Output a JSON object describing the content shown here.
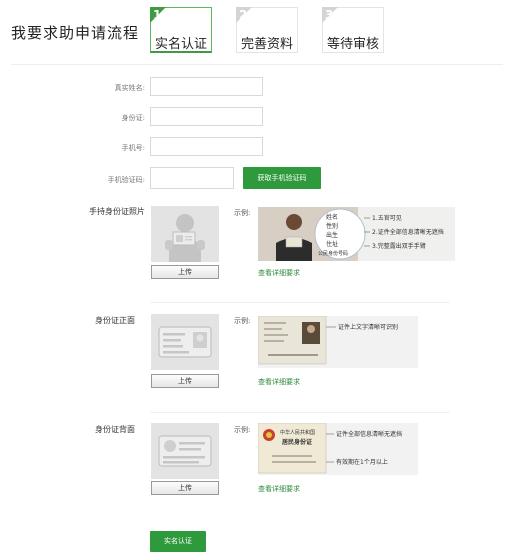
{
  "header": {
    "title": "我要求助申请流程"
  },
  "steps": [
    {
      "num": "1",
      "label": "实名认证",
      "active": true
    },
    {
      "num": "2",
      "label": "完善资料",
      "active": false
    },
    {
      "num": "3",
      "label": "等待审核",
      "active": false
    }
  ],
  "form": {
    "name_label": "真实姓名:",
    "id_label": "身份证:",
    "phone_label": "手机号:",
    "code_label": "手机验证码:",
    "get_code_button": "获取手机验证码"
  },
  "sections": [
    {
      "label": "手持身份证照片",
      "example_label": "示例:",
      "upload_button": "上传",
      "link": "查看详细要求",
      "card_text": [
        "姓名",
        "性别",
        "出生",
        "住址",
        "公民身份号码"
      ],
      "notes": [
        "1.五官可见",
        "2.证件全部信息清晰无遮挡",
        "3.完整露出双手手臂"
      ]
    },
    {
      "label": "身份证正面",
      "example_label": "示例:",
      "upload_button": "上传",
      "link": "查看详细要求",
      "notes": [
        "证件上文字清晰可识别"
      ]
    },
    {
      "label": "身份证背面",
      "example_label": "示例:",
      "upload_button": "上传",
      "link": "查看详细要求",
      "card_text": [
        "中华人民共和国",
        "居民身份证"
      ],
      "notes": [
        "证件全部信息清晰无遮挡",
        "有效期在1个月以上"
      ]
    }
  ],
  "submit": {
    "label": "实名认证"
  },
  "colors": {
    "accent": "#2e9a3c",
    "link": "#2e8b3a",
    "placeholder": "#e3e3e3"
  }
}
